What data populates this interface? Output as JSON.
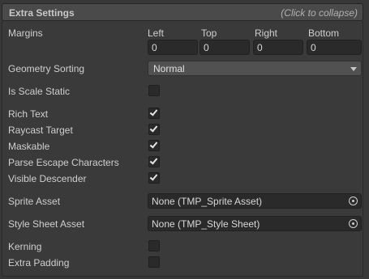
{
  "header": {
    "title": "Extra Settings",
    "collapse_hint": "(Click to collapse)"
  },
  "margins": {
    "label": "Margins",
    "fields": [
      {
        "label": "Left",
        "value": "0"
      },
      {
        "label": "Top",
        "value": "0"
      },
      {
        "label": "Right",
        "value": "0"
      },
      {
        "label": "Bottom",
        "value": "0"
      }
    ]
  },
  "geometry_sorting": {
    "label": "Geometry Sorting",
    "value": "Normal"
  },
  "is_scale_static": {
    "label": "Is Scale Static",
    "checked": false
  },
  "rich_text": {
    "label": "Rich Text",
    "checked": true
  },
  "raycast_target": {
    "label": "Raycast Target",
    "checked": true
  },
  "maskable": {
    "label": "Maskable",
    "checked": true
  },
  "parse_escape": {
    "label": "Parse Escape Characters",
    "checked": true
  },
  "visible_descender": {
    "label": "Visible Descender",
    "checked": true
  },
  "sprite_asset": {
    "label": "Sprite Asset",
    "value": "None (TMP_Sprite Asset)",
    "icon": "object-picker-icon"
  },
  "style_sheet": {
    "label": "Style Sheet Asset",
    "value": "None (TMP_Style Sheet)",
    "icon": "object-picker-icon"
  },
  "kerning": {
    "label": "Kerning",
    "checked": false
  },
  "extra_padding": {
    "label": "Extra Padding",
    "checked": false
  }
}
